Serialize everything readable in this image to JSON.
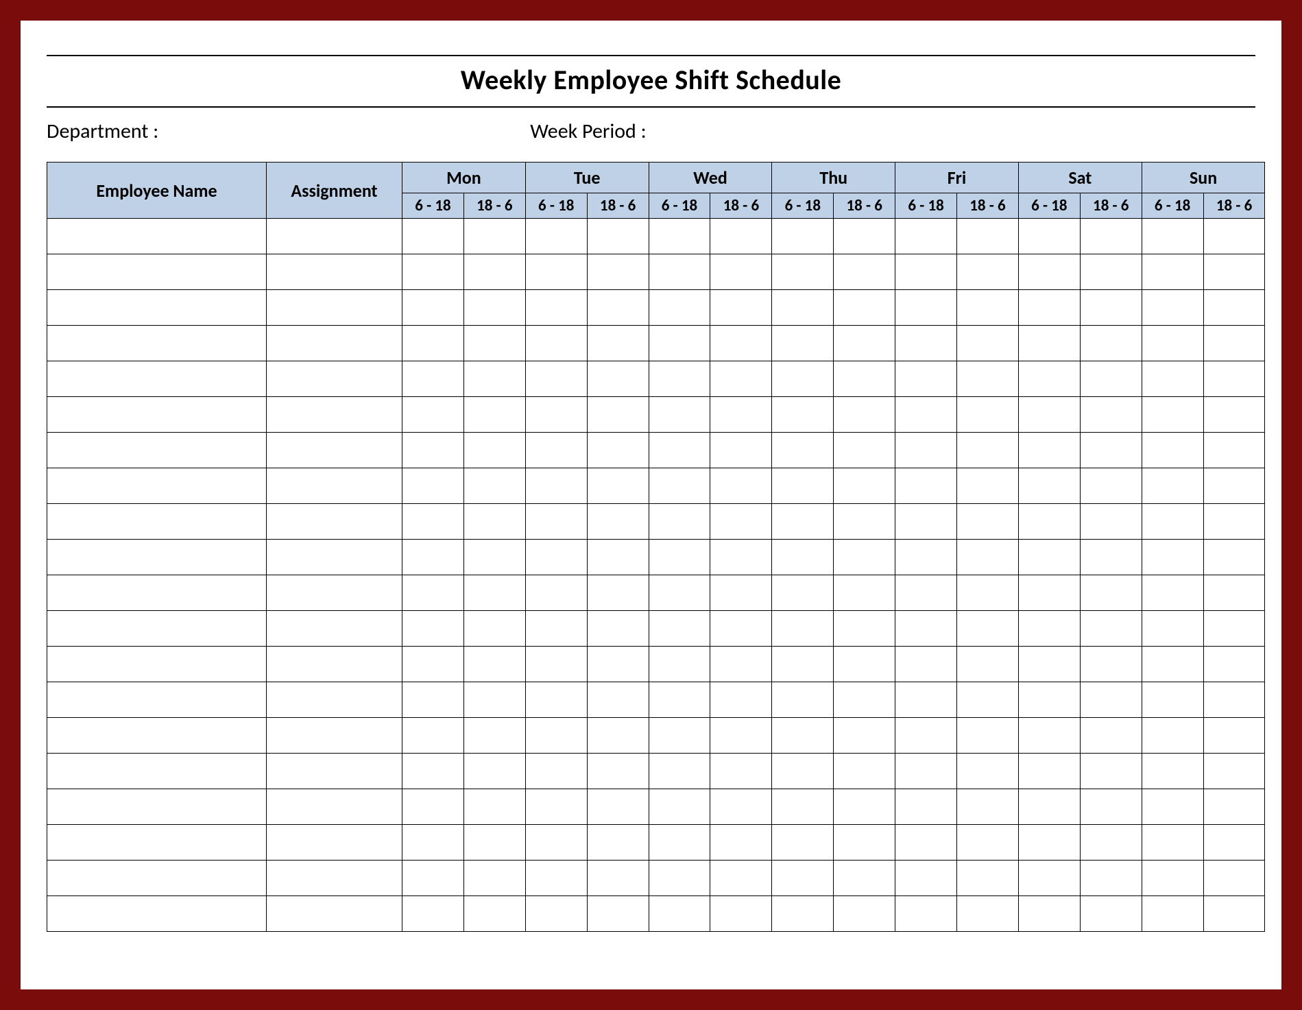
{
  "title": "Weekly Employee Shift Schedule",
  "meta": {
    "department_label": "Department :",
    "week_period_label": "Week  Period :"
  },
  "columns": {
    "employee_name": "Employee Name",
    "assignment": "Assignment",
    "days": [
      "Mon",
      "Tue",
      "Wed",
      "Thu",
      "Fri",
      "Sat",
      "Sun"
    ],
    "shifts": [
      "6 - 18",
      "18 - 6"
    ]
  },
  "row_count": 20
}
